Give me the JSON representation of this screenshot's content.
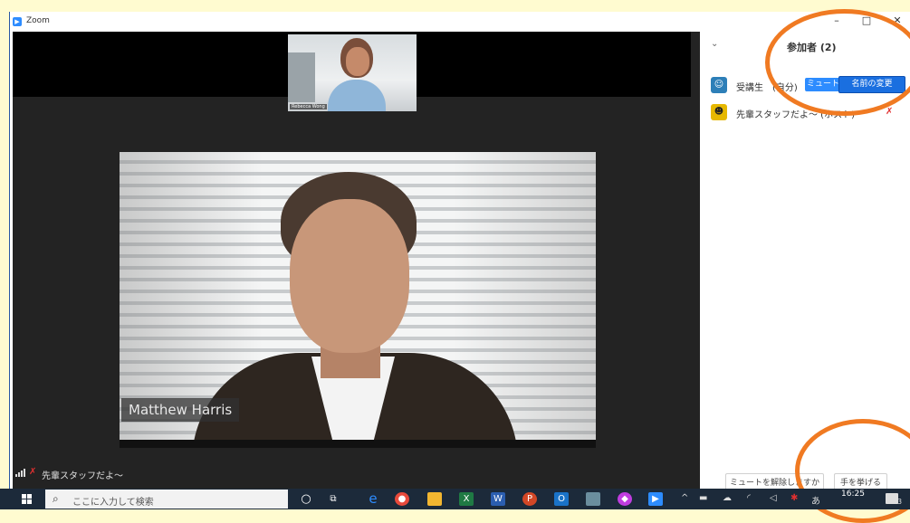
{
  "window": {
    "title": "Zoom"
  },
  "window_controls": {
    "minimize": "–",
    "maximize": "□",
    "close": "✕"
  },
  "thumbnail": {
    "name": "Rebecca Wong"
  },
  "main_video": {
    "name": "Matthew Harris"
  },
  "speaker_bar": {
    "name": "先輩スタッフだよ〜"
  },
  "participants": {
    "title": "参加者 (2)",
    "collapse_icon": "⌄",
    "items": [
      {
        "name": "受講生　(自分)",
        "avatar": "☺",
        "avatar_color": "#2d7fb8",
        "mute_label": "ミュート",
        "rename_label": "名前の変更"
      },
      {
        "name": "先輩スタッフだよ〜 (ホスト)",
        "avatar": "☻",
        "avatar_color": "#e6b800"
      }
    ],
    "footer": {
      "unmute_request": "ミュートを解除しますか",
      "lower_hand": "手を挙げる"
    }
  },
  "taskbar": {
    "search_placeholder": "ここに入力して検索",
    "clock_time": "16:25",
    "notification_count": "3"
  },
  "colors": {
    "accent": "#2d8cff",
    "highlight_circle": "#f07a22"
  }
}
